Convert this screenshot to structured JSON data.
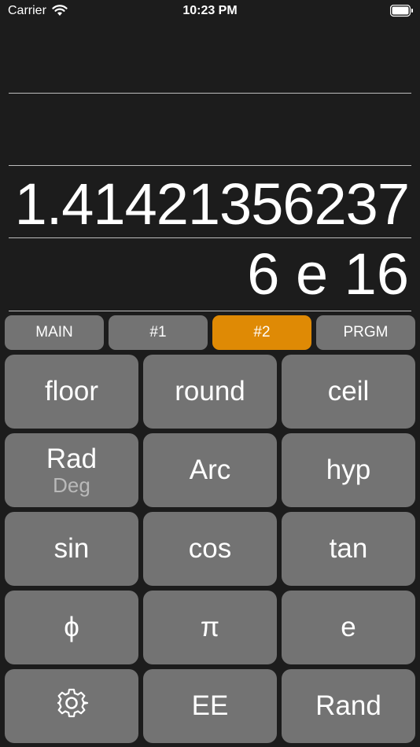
{
  "status_bar": {
    "carrier": "Carrier",
    "time": "10:23 PM"
  },
  "display": {
    "value": "1.41421356237",
    "exponent": "6 e 16"
  },
  "tabs": [
    {
      "label": "MAIN",
      "active": false
    },
    {
      "label": "#1",
      "active": false
    },
    {
      "label": "#2",
      "active": true
    },
    {
      "label": "PRGM",
      "active": false
    }
  ],
  "keys": {
    "floor": "floor",
    "round": "round",
    "ceil": "ceil",
    "rad": "Rad",
    "deg": "Deg",
    "arc": "Arc",
    "hyp": "hyp",
    "sin": "sin",
    "cos": "cos",
    "tan": "tan",
    "phi": "ϕ",
    "pi": "π",
    "e": "e",
    "settings_icon": "gear-icon",
    "ee": "EE",
    "rand": "Rand"
  },
  "colors": {
    "background": "#1c1c1c",
    "key": "#737373",
    "accent": "#df8a05"
  }
}
